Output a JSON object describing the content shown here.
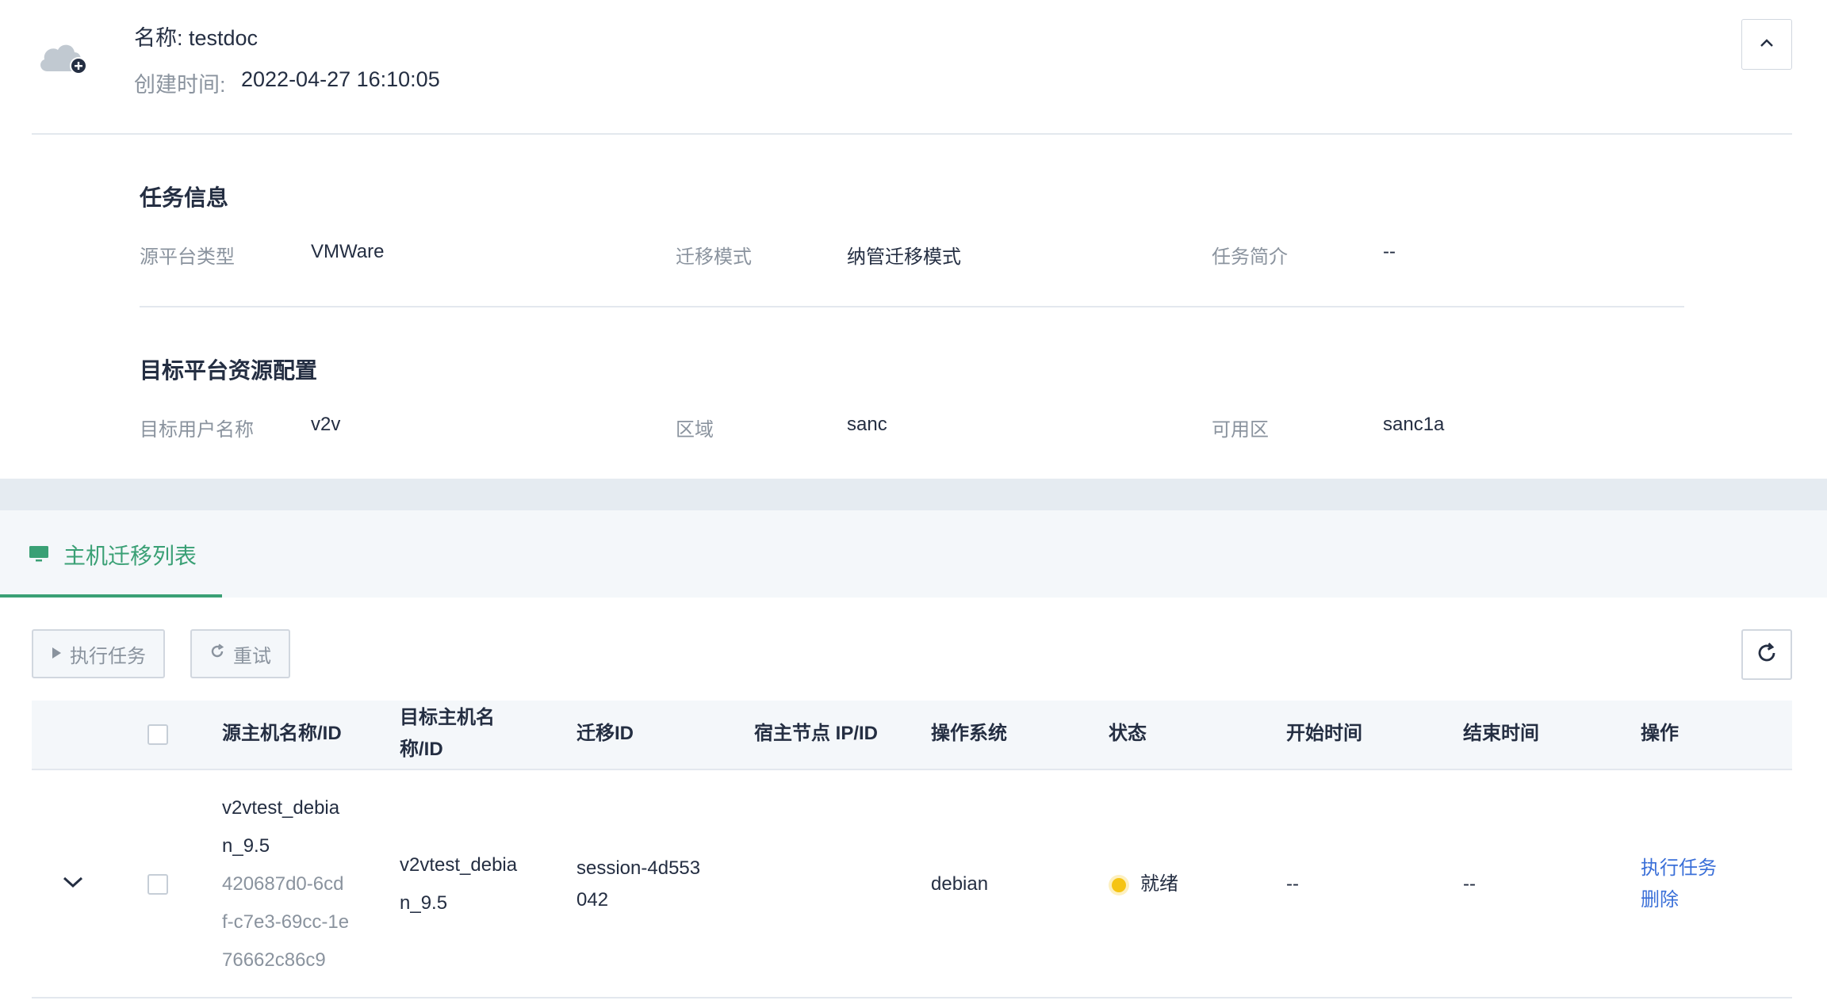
{
  "header": {
    "name": "名称: testdoc",
    "created_label": "创建时间:",
    "created_value": "2022-04-27 16:10:05"
  },
  "task_info": {
    "title": "任务信息",
    "source_platform_label": "源平台类型",
    "source_platform_value": "VMWare",
    "mode_label": "迁移模式",
    "mode_value": "纳管迁移模式",
    "desc_label": "任务简介",
    "desc_value": "--"
  },
  "target_config": {
    "title": "目标平台资源配置",
    "user_label": "目标用户名称",
    "user_value": "v2v",
    "region_label": "区域",
    "region_value": "sanc",
    "zone_label": "可用区",
    "zone_value": "sanc1a"
  },
  "tab": {
    "label": "主机迁移列表"
  },
  "toolbar": {
    "execute_label": "执行任务",
    "retry_label": "重试"
  },
  "table": {
    "headers": {
      "source_host": "源主机名称/ID",
      "target_host_1": "目标主机名",
      "target_host_2": "称/ID",
      "migration_id": "迁移ID",
      "host_node": "宿主节点 IP/ID",
      "os": "操作系统",
      "status": "状态",
      "start_time": "开始时间",
      "end_time": "结束时间",
      "actions": "操作"
    },
    "rows": [
      {
        "source_name_1": "v2vtest_debia",
        "source_name_2": "n_9.5",
        "source_id_1": "420687d0-6cd",
        "source_id_2": "f-c7e3-69cc-1e",
        "source_id_3": "76662c86c9",
        "target_name_1": "v2vtest_debia",
        "target_name_2": "n_9.5",
        "migration_id_1": "session-4d553",
        "migration_id_2": "042",
        "os": "debian",
        "status": "就绪",
        "status_color": "#f5c414",
        "start_time": "--",
        "end_time": "--",
        "action_execute": "执行任务",
        "action_delete": "删除"
      }
    ]
  },
  "colors": {
    "accent_green": "#3aa075",
    "link_blue": "#3a6fd8",
    "text_dark": "#242e42",
    "text_muted": "#8a939e"
  }
}
